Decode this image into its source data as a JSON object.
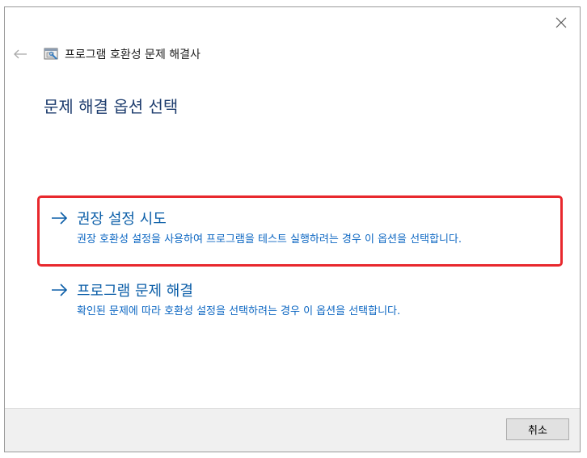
{
  "window": {
    "title": "프로그램 호환성 문제 해결사",
    "icons": {
      "back": "back-arrow-icon",
      "close": "close-icon",
      "app": "compatibility-troubleshooter-icon"
    }
  },
  "main": {
    "heading": "문제 해결 옵션 선택",
    "options": [
      {
        "title": "권장 설정 시도",
        "description": "권장 호환성 설정을 사용하여 프로그램을 테스트 실행하려는 경우 이 옵션을 선택합니다.",
        "highlighted": true
      },
      {
        "title": "프로그램 문제 해결",
        "description": "확인된 문제에 따라 호환성 설정을 선택하려는 경우 이 옵션을 선택합니다.",
        "highlighted": false
      }
    ]
  },
  "footer": {
    "cancel_label": "취소"
  },
  "colors": {
    "link": "#0b5ea8",
    "heading": "#1e3d6e",
    "highlight_border": "#e8282d"
  }
}
